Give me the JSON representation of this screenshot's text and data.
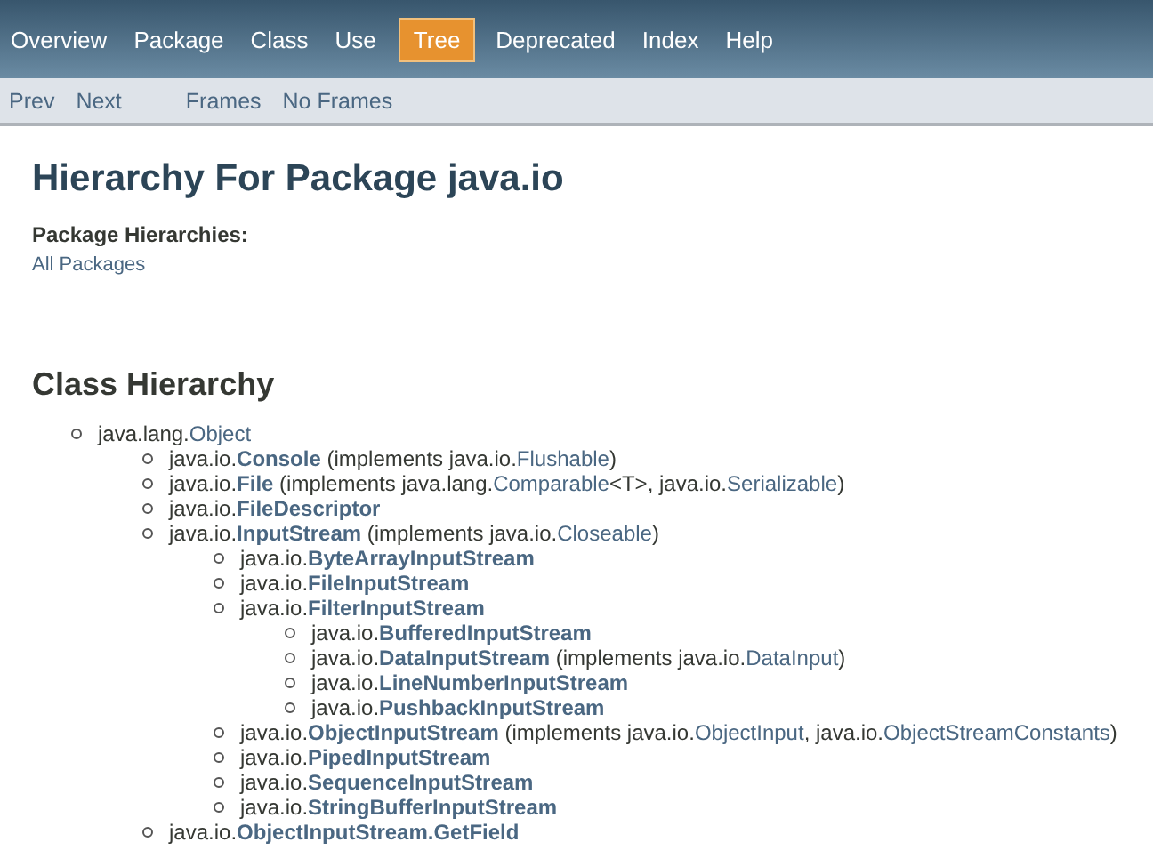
{
  "top_nav": [
    {
      "label": "Overview",
      "selected": false
    },
    {
      "label": "Package",
      "selected": false
    },
    {
      "label": "Class",
      "selected": false
    },
    {
      "label": "Use",
      "selected": false
    },
    {
      "label": "Tree",
      "selected": true
    },
    {
      "label": "Deprecated",
      "selected": false
    },
    {
      "label": "Index",
      "selected": false
    },
    {
      "label": "Help",
      "selected": false
    }
  ],
  "sub_nav": [
    [
      "Prev",
      "Next"
    ],
    [
      "Frames",
      "No Frames"
    ]
  ],
  "title": "Hierarchy For Package java.io",
  "package_hierarchies": {
    "label": "Package Hierarchies:",
    "link": "All Packages"
  },
  "section_title": "Class Hierarchy",
  "tree": [
    {
      "parts": [
        {
          "kind": "plain",
          "text": "java.lang."
        },
        {
          "kind": "link",
          "text": "Object"
        }
      ],
      "children": [
        {
          "parts": [
            {
              "kind": "plain",
              "text": "java.io."
            },
            {
              "kind": "class",
              "text": "Console"
            },
            {
              "kind": "plain",
              "text": " (implements java.io."
            },
            {
              "kind": "link",
              "text": "Flushable"
            },
            {
              "kind": "plain",
              "text": ")"
            }
          ]
        },
        {
          "parts": [
            {
              "kind": "plain",
              "text": "java.io."
            },
            {
              "kind": "class",
              "text": "File"
            },
            {
              "kind": "plain",
              "text": " (implements java.lang."
            },
            {
              "kind": "link",
              "text": "Comparable"
            },
            {
              "kind": "plain",
              "text": "<T>, java.io."
            },
            {
              "kind": "link",
              "text": "Serializable"
            },
            {
              "kind": "plain",
              "text": ")"
            }
          ]
        },
        {
          "parts": [
            {
              "kind": "plain",
              "text": "java.io."
            },
            {
              "kind": "class",
              "text": "FileDescriptor"
            }
          ]
        },
        {
          "parts": [
            {
              "kind": "plain",
              "text": "java.io."
            },
            {
              "kind": "class",
              "text": "InputStream"
            },
            {
              "kind": "plain",
              "text": " (implements java.io."
            },
            {
              "kind": "link",
              "text": "Closeable"
            },
            {
              "kind": "plain",
              "text": ")"
            }
          ],
          "children": [
            {
              "parts": [
                {
                  "kind": "plain",
                  "text": "java.io."
                },
                {
                  "kind": "class",
                  "text": "ByteArrayInputStream"
                }
              ]
            },
            {
              "parts": [
                {
                  "kind": "plain",
                  "text": "java.io."
                },
                {
                  "kind": "class",
                  "text": "FileInputStream"
                }
              ]
            },
            {
              "parts": [
                {
                  "kind": "plain",
                  "text": "java.io."
                },
                {
                  "kind": "class",
                  "text": "FilterInputStream"
                }
              ],
              "children": [
                {
                  "parts": [
                    {
                      "kind": "plain",
                      "text": "java.io."
                    },
                    {
                      "kind": "class",
                      "text": "BufferedInputStream"
                    }
                  ]
                },
                {
                  "parts": [
                    {
                      "kind": "plain",
                      "text": "java.io."
                    },
                    {
                      "kind": "class",
                      "text": "DataInputStream"
                    },
                    {
                      "kind": "plain",
                      "text": " (implements java.io."
                    },
                    {
                      "kind": "link",
                      "text": "DataInput"
                    },
                    {
                      "kind": "plain",
                      "text": ")"
                    }
                  ]
                },
                {
                  "parts": [
                    {
                      "kind": "plain",
                      "text": "java.io."
                    },
                    {
                      "kind": "class",
                      "text": "LineNumberInputStream"
                    }
                  ]
                },
                {
                  "parts": [
                    {
                      "kind": "plain",
                      "text": "java.io."
                    },
                    {
                      "kind": "class",
                      "text": "PushbackInputStream"
                    }
                  ]
                }
              ]
            },
            {
              "parts": [
                {
                  "kind": "plain",
                  "text": "java.io."
                },
                {
                  "kind": "class",
                  "text": "ObjectInputStream"
                },
                {
                  "kind": "plain",
                  "text": " (implements java.io."
                },
                {
                  "kind": "link",
                  "text": "ObjectInput"
                },
                {
                  "kind": "plain",
                  "text": ", java.io."
                },
                {
                  "kind": "link",
                  "text": "ObjectStreamConstants"
                },
                {
                  "kind": "plain",
                  "text": ")"
                }
              ]
            },
            {
              "parts": [
                {
                  "kind": "plain",
                  "text": "java.io."
                },
                {
                  "kind": "class",
                  "text": "PipedInputStream"
                }
              ]
            },
            {
              "parts": [
                {
                  "kind": "plain",
                  "text": "java.io."
                },
                {
                  "kind": "class",
                  "text": "SequenceInputStream"
                }
              ]
            },
            {
              "parts": [
                {
                  "kind": "plain",
                  "text": "java.io."
                },
                {
                  "kind": "class",
                  "text": "StringBufferInputStream"
                }
              ]
            }
          ]
        },
        {
          "parts": [
            {
              "kind": "plain",
              "text": "java.io."
            },
            {
              "kind": "class",
              "text": "ObjectInputStream.GetField"
            }
          ]
        }
      ]
    }
  ]
}
